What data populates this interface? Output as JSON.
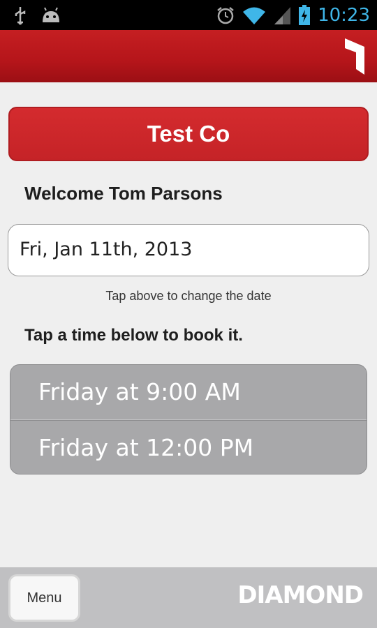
{
  "status_bar": {
    "time": "10:23",
    "icons": [
      "usb-icon",
      "android-icon",
      "alarm-icon",
      "wifi-icon",
      "signal-icon",
      "battery-icon"
    ]
  },
  "header": {
    "logo_icon": "app-logo-icon",
    "accent_color": "#b5151a"
  },
  "company": {
    "name": "Test Co",
    "color": "#d0292c"
  },
  "welcome_text": "Welcome Tom Parsons",
  "date_picker": {
    "value": "Fri, Jan 11th, 2013",
    "hint": "Tap above to change the date"
  },
  "instruction": "Tap a time below to book it.",
  "time_slots": [
    {
      "label": "Friday at 9:00 AM"
    },
    {
      "label": "Friday at 12:00 PM"
    }
  ],
  "bottom_bar": {
    "menu_label": "Menu",
    "brand": "DIAMOND"
  }
}
